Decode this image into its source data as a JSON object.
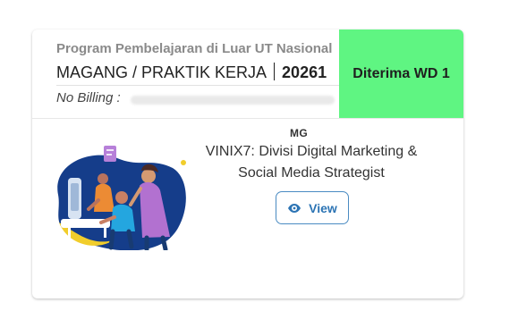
{
  "program": {
    "title": "Program Pembelajaran di Luar UT Nasional",
    "course_name": "MAGANG / PRAKTIK KERJA",
    "course_code": "20261",
    "billing_label": "No Billing : "
  },
  "status": {
    "label": "Diterima WD 1",
    "color": "#5ff582"
  },
  "activity": {
    "category_code": "MG",
    "title": "VINIX7: Divisi Digital Marketing & Social Media Strategist",
    "illustration_icon": "team-working-illustration"
  },
  "actions": {
    "view_label": "View",
    "view_icon": "eye-icon"
  }
}
